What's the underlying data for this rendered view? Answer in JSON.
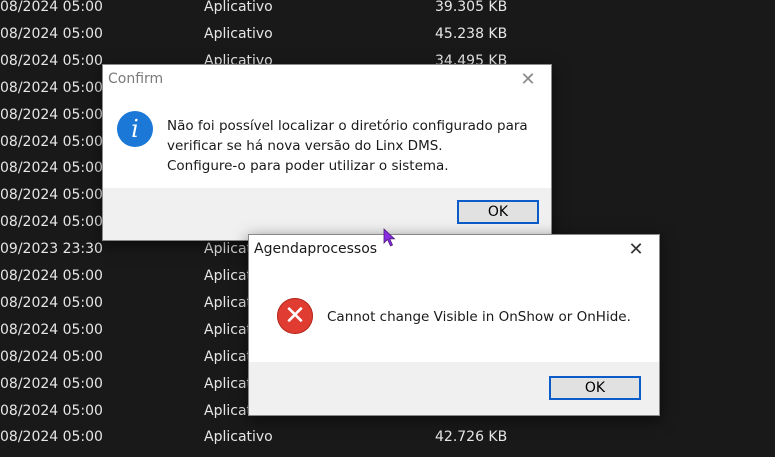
{
  "file_list": [
    {
      "date": "08/2024 05:00",
      "type": "Aplicativo",
      "size": "39.305 KB"
    },
    {
      "date": "08/2024 05:00",
      "type": "Aplicativo",
      "size": "45.238 KB"
    },
    {
      "date": "08/2024 05:00",
      "type": "Aplicativo",
      "size": "34.495 KB"
    },
    {
      "date": "08/2024 05:00",
      "type": "",
      "size": ""
    },
    {
      "date": "08/2024 05:00",
      "type": "",
      "size": ""
    },
    {
      "date": "08/2024 05:00",
      "type": "",
      "size": ""
    },
    {
      "date": "08/2024 05:00",
      "type": "",
      "size": ""
    },
    {
      "date": "08/2024 05:00",
      "type": "",
      "size": ""
    },
    {
      "date": "08/2024 05:00",
      "type": "",
      "size": ""
    },
    {
      "date": "09/2023 23:30",
      "type": "Aplicat",
      "size": ""
    },
    {
      "date": "08/2024 05:00",
      "type": "Aplicat",
      "size": ""
    },
    {
      "date": "08/2024 05:00",
      "type": "Aplicat",
      "size": ""
    },
    {
      "date": "08/2024 05:00",
      "type": "Aplicat",
      "size": ""
    },
    {
      "date": "08/2024 05:00",
      "type": "Aplicat",
      "size": ""
    },
    {
      "date": "08/2024 05:00",
      "type": "Aplicat",
      "size": ""
    },
    {
      "date": "08/2024 05:00",
      "type": "Aplicat",
      "size": ""
    },
    {
      "date": "08/2024 05:00",
      "type": "Aplicativo",
      "size": "42.726 KB"
    }
  ],
  "confirm_dialog": {
    "title": "Confirm",
    "close_glyph": "✕",
    "icon": "info-icon",
    "icon_glyph": "i",
    "message_lines": [
      "Não foi possível localizar o diretório configurado para",
      "verificar se há nova versão do Linx DMS.",
      "Configure-o para poder utilizar o sistema."
    ],
    "ok_label": "OK"
  },
  "error_dialog": {
    "title": "Agendaprocessos",
    "close_glyph": "✕",
    "icon": "error-icon",
    "icon_glyph": "✕",
    "message": "Cannot change Visible in OnShow or OnHide.",
    "ok_label": "OK"
  },
  "colors": {
    "background": "#191919",
    "accent": "#0a5cc8",
    "info_icon": "#1b78d6",
    "error_icon": "#e03c31",
    "cursor": "#8a2be2"
  }
}
